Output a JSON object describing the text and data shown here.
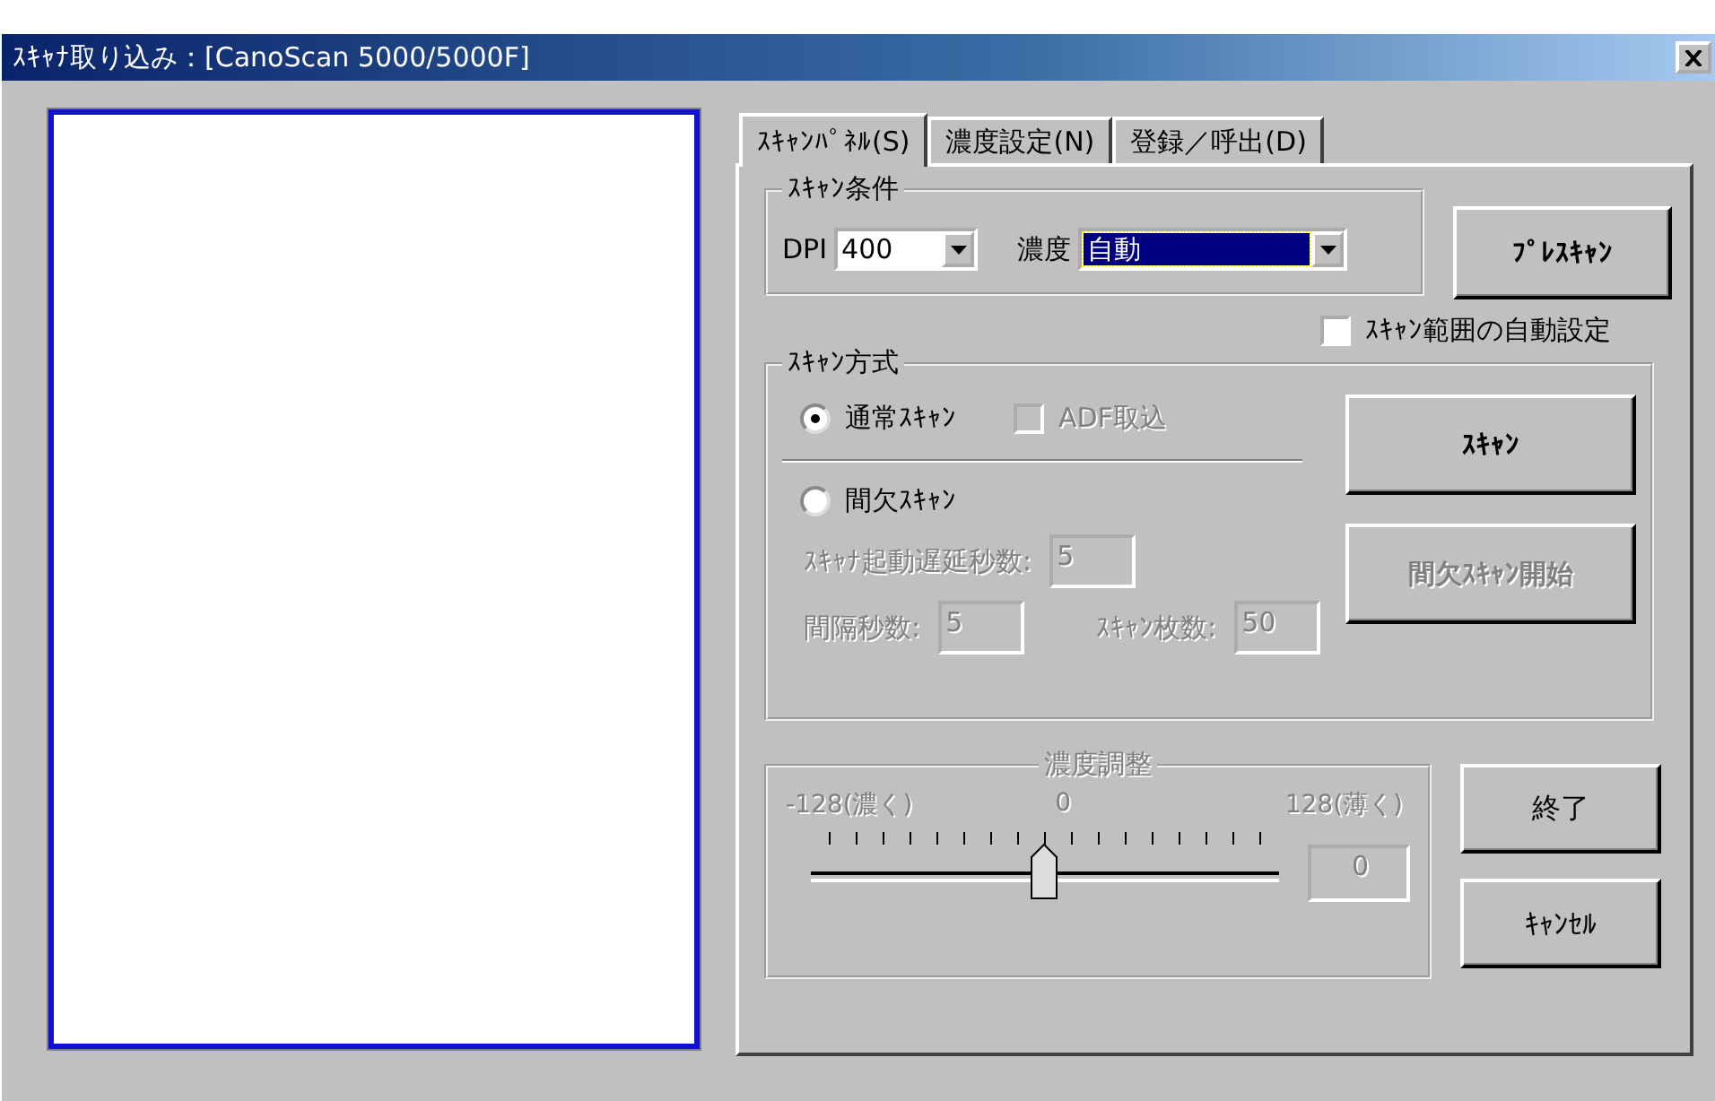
{
  "window": {
    "title": "ｽｷｬﾅ取り込み：[CanoScan 5000/5000F]"
  },
  "tabs": [
    {
      "label": "ｽｷｬﾝﾊﾟﾈﾙ(S)",
      "selected": true
    },
    {
      "label": "濃度設定(N)",
      "selected": false
    },
    {
      "label": "登録／呼出(D)",
      "selected": false
    }
  ],
  "scan_conditions": {
    "legend": "ｽｷｬﾝ条件",
    "dpi_label": "DPI",
    "dpi_value": "400",
    "density_label": "濃度",
    "density_value": "自動"
  },
  "prescan_button": {
    "label": "ﾌﾟﾚｽｷｬﾝ",
    "disabled": false
  },
  "auto_range": {
    "label": "ｽｷｬﾝ範囲の自動設定",
    "checked": false,
    "disabled": false
  },
  "scan_method": {
    "legend": "ｽｷｬﾝ方式",
    "normal": {
      "label": "通常ｽｷｬﾝ",
      "selected": true
    },
    "adf": {
      "label": "ADF取込",
      "checked": false,
      "disabled": true
    },
    "intermittent": {
      "label": "間欠ｽｷｬﾝ",
      "selected": false
    },
    "delay": {
      "label": "ｽｷｬﾅ起動遅延秒数:",
      "value": "5",
      "disabled": true
    },
    "interval": {
      "label": "間隔秒数:",
      "value": "5",
      "disabled": true
    },
    "count": {
      "label": "ｽｷｬﾝ枚数:",
      "value": "50",
      "disabled": true
    },
    "scan_button": {
      "label": "ｽｷｬﾝ",
      "disabled": false
    },
    "start_button": {
      "label": "間欠ｽｷｬﾝ開始",
      "disabled": true
    }
  },
  "density_adjust": {
    "legend": "濃度調整",
    "disabled": true,
    "min_label": "-128(濃く)",
    "mid_label": "0",
    "max_label": "128(薄く)",
    "level": 0.5,
    "value": "0"
  },
  "buttons": [
    {
      "label": "終了",
      "disabled": false
    },
    {
      "label": "ｷｬﾝｾﾙ",
      "disabled": false
    }
  ]
}
